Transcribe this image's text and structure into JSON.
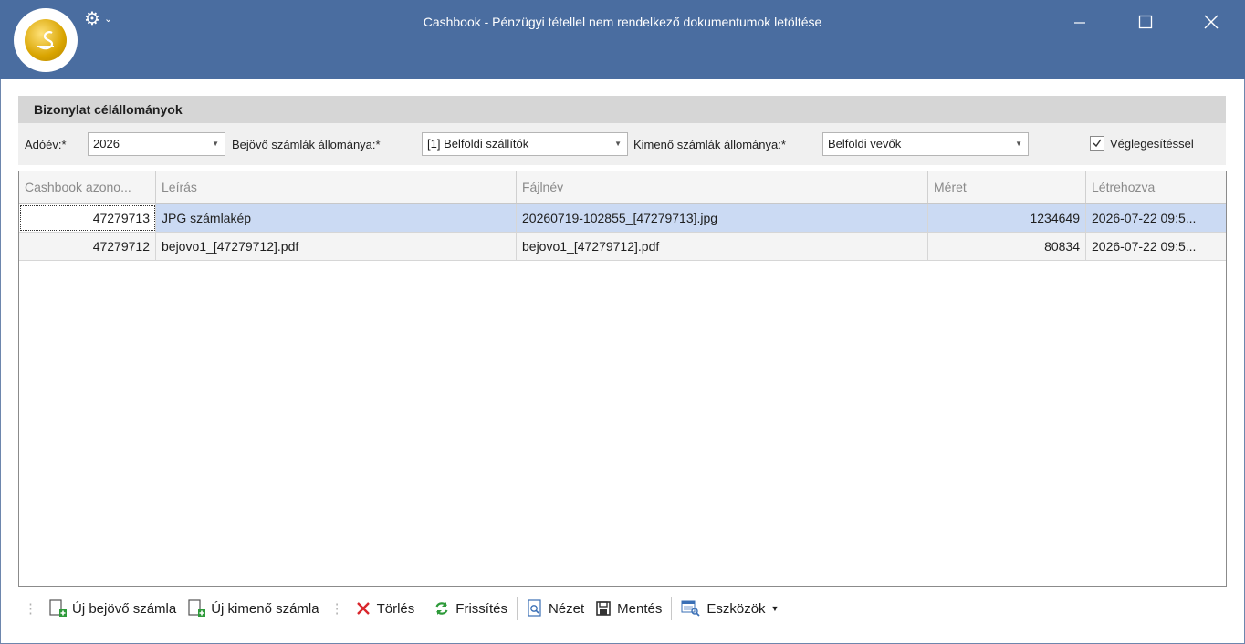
{
  "window": {
    "title": "Cashbook - Pénzügyi tétellel nem rendelkező dokumentumok letöltése"
  },
  "group": {
    "header": "Bizonylat célállományok",
    "year_label": "Adóév:*",
    "year_value": "2026",
    "incoming_label": "Bejövő számlák állománya:*",
    "incoming_value": "[1] Belföldi szállítók",
    "outgoing_label": "Kimenő számlák állománya:*",
    "outgoing_value": "Belföldi vevők",
    "finalize_label": "Véglegesítéssel",
    "finalize_checked": true
  },
  "grid": {
    "columns": [
      "Cashbook azono...",
      "Leírás",
      "Fájlnév",
      "Méret",
      "Létrehozva"
    ],
    "rows": [
      {
        "id": "47279713",
        "description": "JPG számlakép",
        "filename": "20260719-102855_[47279713].jpg",
        "size": "1234649",
        "created": "2026-07-22 09:5..."
      },
      {
        "id": "47279712",
        "description": "bejovo1_[47279712].pdf",
        "filename": "bejovo1_[47279712].pdf",
        "size": "80834",
        "created": "2026-07-22 09:5..."
      }
    ]
  },
  "toolbar": {
    "new_incoming": "Új bejövő számla",
    "new_outgoing": "Új kimenő számla",
    "delete": "Törlés",
    "refresh": "Frissítés",
    "view": "Nézet",
    "save": "Mentés",
    "tools": "Eszközök"
  },
  "colors": {
    "titlebar": "#4a6da0",
    "selection": "#cbdaf3",
    "delete_icon": "#d9262c",
    "refresh_icon": "#2e9a3a",
    "add_icon": "#2e9a3a"
  },
  "icons": [
    "app-logo-icon",
    "gear-icon",
    "minimize-icon",
    "maximize-icon",
    "close-icon",
    "new-document-icon",
    "delete-icon",
    "refresh-icon",
    "view-icon",
    "save-icon",
    "tools-icon"
  ]
}
